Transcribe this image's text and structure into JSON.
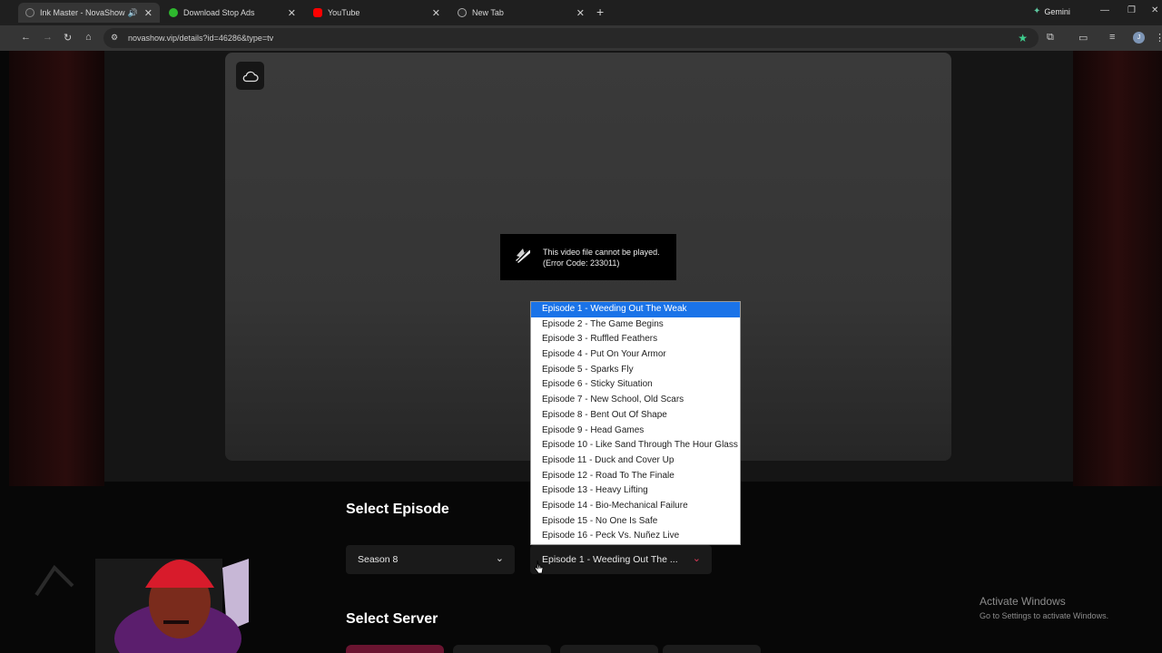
{
  "browser": {
    "tabs": [
      {
        "label": "Ink Master - NovaShow",
        "active": true,
        "favicon_color": "#3a3a3a"
      },
      {
        "label": "Download Stop Ads",
        "active": false,
        "favicon_color": "#2eb82e"
      },
      {
        "label": "YouTube",
        "active": false,
        "favicon_color": "#ff0000"
      },
      {
        "label": "New Tab",
        "active": false,
        "favicon_color": "#6a6a6a"
      }
    ],
    "gemini_label": "Gemini",
    "url": "novashow.vip/details?id=46286&type=tv"
  },
  "player": {
    "error_line1": "This video file cannot be played.",
    "error_line2": "(Error Code: 233011)"
  },
  "episode_section": {
    "title": "Select Episode",
    "season_value": "Season 8",
    "episode_value": "Episode 1 - Weeding Out The ...",
    "options": [
      "Episode 1 - Weeding Out The Weak",
      "Episode 2 - The Game Begins",
      "Episode 3 - Ruffled Feathers",
      "Episode 4 - Put On Your Armor",
      "Episode 5 - Sparks Fly",
      "Episode 6 - Sticky Situation",
      "Episode 7 - New School, Old Scars",
      "Episode 8 - Bent Out Of Shape",
      "Episode 9 - Head Games",
      "Episode 10 - Like Sand Through The Hour Glass",
      "Episode 11 - Duck and Cover Up",
      "Episode 12 - Road To The Finale",
      "Episode 13 - Heavy Lifting",
      "Episode 14 - Bio-Mechanical Failure",
      "Episode 15 - No One Is Safe",
      "Episode 16 - Peck Vs. Nuñez Live"
    ]
  },
  "server_section": {
    "title": "Select Server"
  },
  "windows_watermark": {
    "line1": "Activate Windows",
    "line2": "Go to Settings to activate Windows."
  },
  "colors": {
    "accent": "#e03a5a",
    "dropdown_selected": "#1a73e8"
  }
}
